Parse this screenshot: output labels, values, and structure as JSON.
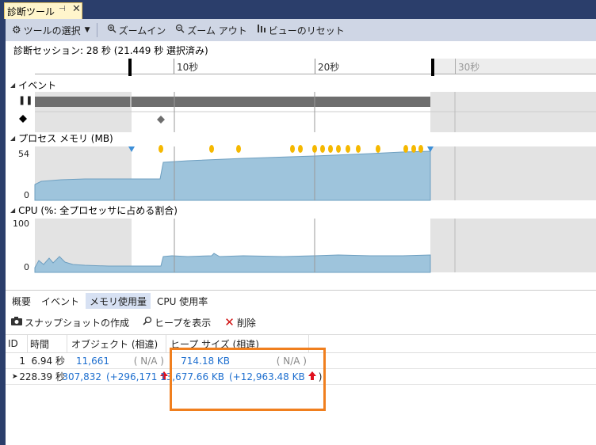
{
  "window": {
    "tab_title": "診断ツール",
    "tab_pin": "⊣",
    "tab_close": "✕"
  },
  "toolbar": {
    "tools_label": "ツールの選択",
    "zoom_in_label": "ズームイン",
    "zoom_out_label": "ズーム アウト",
    "reset_view_label": "ビューのリセット"
  },
  "session": {
    "text": "診断セッション: 28 秒 (21.449 秒 選択済み)"
  },
  "ruler": {
    "labels": [
      "10秒",
      "20秒",
      "30秒"
    ]
  },
  "sections": {
    "events": "イベント",
    "memory": "プロセス メモリ (MB)",
    "memory_max": "54",
    "memory_min": "0",
    "cpu": "CPU (%: 全プロセッサに占める割合)",
    "cpu_max": "100",
    "cpu_min": "0"
  },
  "subtabs": [
    "概要",
    "イベント",
    "メモリ使用量",
    "CPU 使用率"
  ],
  "subtab_active": 2,
  "actions": {
    "snapshot": "スナップショットの作成",
    "view_heap": "ヒープを表示",
    "delete": "削除"
  },
  "table": {
    "headers": {
      "id": "ID",
      "time": "時間",
      "objects": "オブジェクト (相違)",
      "heap": "ヒープ サイズ (相違)"
    },
    "rows": [
      {
        "id": "1",
        "time": "6.94 秒",
        "objects": "11,661",
        "objects_diff": "( N/A )",
        "heap": "714.18 KB",
        "heap_diff": "( N/A )"
      },
      {
        "id": "2",
        "time": "28.39 秒",
        "objects": "307,832",
        "objects_diff": "(+296,171",
        "heap": "13,677.66 KB",
        "heap_diff": "(+12,963.48 KB",
        "heap_diff_close": ")"
      }
    ]
  },
  "colors": {
    "accent_orange": "#f07f1e",
    "chart_fill": "#9ec4dc",
    "selection_gray": "#e0e0e0",
    "marker_orange": "#f5b800",
    "marker_blue": "#3d8fd8",
    "increase_red": "#e0101e",
    "link_blue": "#1e6fcf"
  },
  "icons": {
    "tools": "gear-icon",
    "zoom_in": "zoom-in-icon",
    "zoom_out": "zoom-out-icon",
    "reset": "reset-view-icon",
    "snapshot": "camera-icon",
    "view_heap": "search-icon",
    "delete": "delete-icon",
    "increase": "arrow-up-icon",
    "current_row": "current-row-arrow-icon"
  }
}
